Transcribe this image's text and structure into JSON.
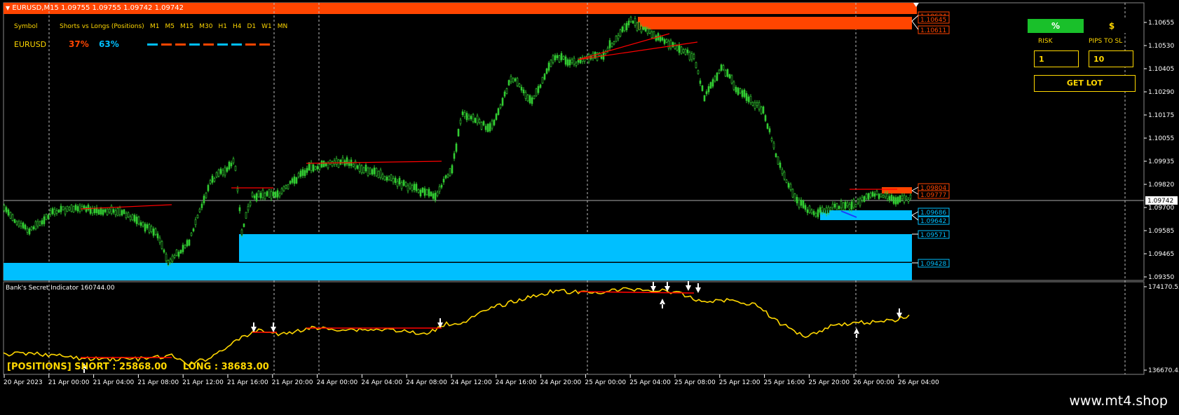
{
  "header": {
    "title": "EURUSD,M15  1.09755 1.09755 1.09742 1.09742",
    "bar_color": "#ff4500"
  },
  "positions_panel": {
    "col_symbol": "Symbol",
    "col_ratio": "Shorts vs Longs (Positions)",
    "timeframes": [
      "M1",
      "M5",
      "M15",
      "M30",
      "H1",
      "H4",
      "D1",
      "W1",
      "MN"
    ],
    "symbol": "EURUSD",
    "shorts_pct": "37%",
    "longs_pct": "63%",
    "tf_colors": [
      "#00bfff",
      "#ff4500",
      "#ff4500",
      "#00bfff",
      "#ff4500",
      "#00bfff",
      "#00bfff",
      "#ff4500",
      "#ff4500"
    ]
  },
  "risk_panel": {
    "pct_label": "%",
    "usd_label": "$",
    "risk_label": "RISK",
    "pips_label": "PIPS TO SL",
    "risk_value": "1",
    "pips_value": "10",
    "getlot_label": "GET LOT"
  },
  "price_axis": {
    "ticks": [
      "1.10655",
      "1.10530",
      "1.10405",
      "1.10290",
      "1.10175",
      "1.10055",
      "1.09935",
      "1.09820",
      "1.09700",
      "1.09585",
      "1.09465",
      "1.09350"
    ],
    "current_price": "1.09742"
  },
  "zone_labels": {
    "supply": [
      "1.10634",
      "1.10645",
      "1.10611",
      "1.09804",
      "1.09777"
    ],
    "demand": [
      "1.09686",
      "1.09642",
      "1.09571",
      "1.09428"
    ]
  },
  "indicator": {
    "title": "Bank's Secret Indicator 160744.00",
    "axis_top": "174170.55",
    "axis_bottom": "136670.45",
    "positions_text": "[POSITIONS] SHORT : 25868.00     LONG : 38683.00"
  },
  "time_axis": {
    "labels": [
      "20 Apr 2023",
      "21 Apr 00:00",
      "21 Apr 04:00",
      "21 Apr 08:00",
      "21 Apr 12:00",
      "21 Apr 16:00",
      "21 Apr 20:00",
      "24 Apr 00:00",
      "24 Apr 04:00",
      "24 Apr 08:00",
      "24 Apr 12:00",
      "24 Apr 16:00",
      "24 Apr 20:00",
      "25 Apr 00:00",
      "25 Apr 04:00",
      "25 Apr 08:00",
      "25 Apr 12:00",
      "25 Apr 16:00",
      "25 Apr 20:00",
      "26 Apr 00:00",
      "26 Apr 04:00"
    ]
  },
  "footer": {
    "watermark": "www.mt4.shop"
  },
  "colors": {
    "candle": "#32cd32",
    "supply": "#ff4500",
    "demand": "#00bfff",
    "indicator_line": "#ffd700",
    "trend_line": "#ff0000"
  }
}
